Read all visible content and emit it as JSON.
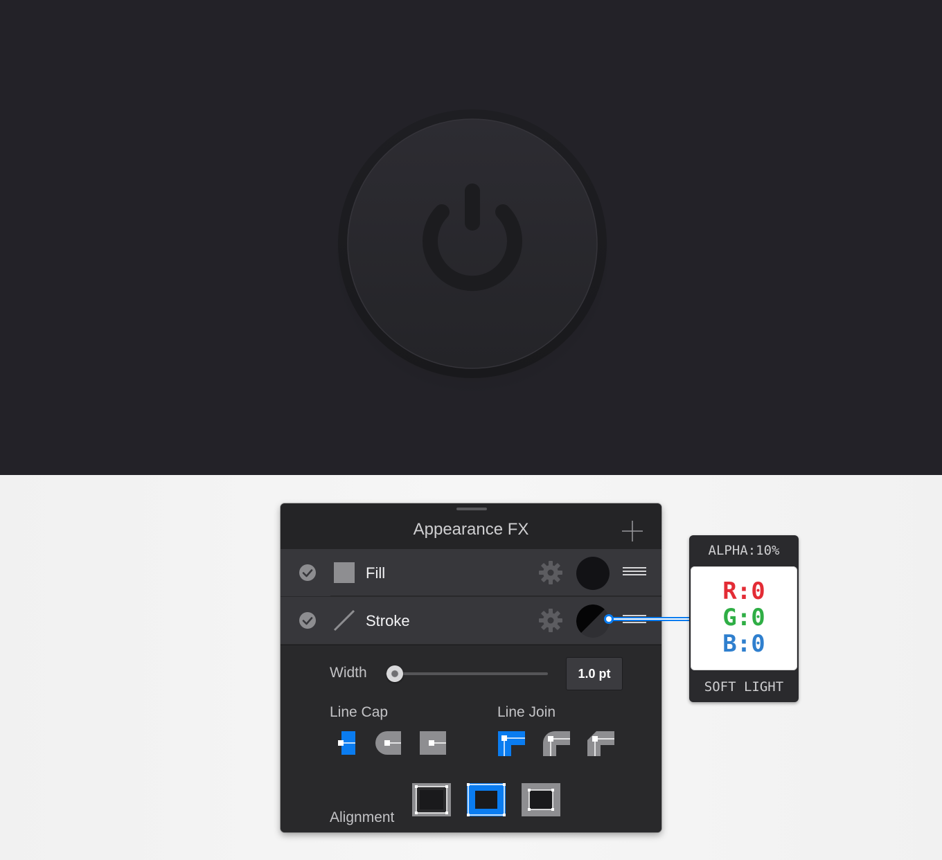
{
  "panel": {
    "title": "Appearance FX",
    "rows": [
      {
        "label": "Fill",
        "enabled": true,
        "swatch_color": "#121215"
      },
      {
        "label": "Stroke",
        "enabled": true
      }
    ],
    "stroke_settings": {
      "width_label": "Width",
      "width_value": "1.0 pt",
      "line_cap_label": "Line Cap",
      "line_join_label": "Line Join",
      "alignment_label": "Alignment",
      "line_cap_selected": 0,
      "line_join_selected": 0,
      "alignment_selected": 1
    }
  },
  "tooltip": {
    "alpha": "ALPHA:10%",
    "r": "R:0",
    "g": "G:0",
    "b": "B:0",
    "blend_mode": "SOFT LIGHT"
  },
  "colors": {
    "accent": "#0a7cf0",
    "canvas_bg": "#232228",
    "panel_bg": "#29292b",
    "r": "#e32c35",
    "g": "#2fae45",
    "b": "#2f7fce"
  },
  "icons": {
    "canvas": "power-icon",
    "row_check": "checkmark-icon",
    "row_settings": "gear-icon",
    "row_menu": "hamburger-icon"
  }
}
